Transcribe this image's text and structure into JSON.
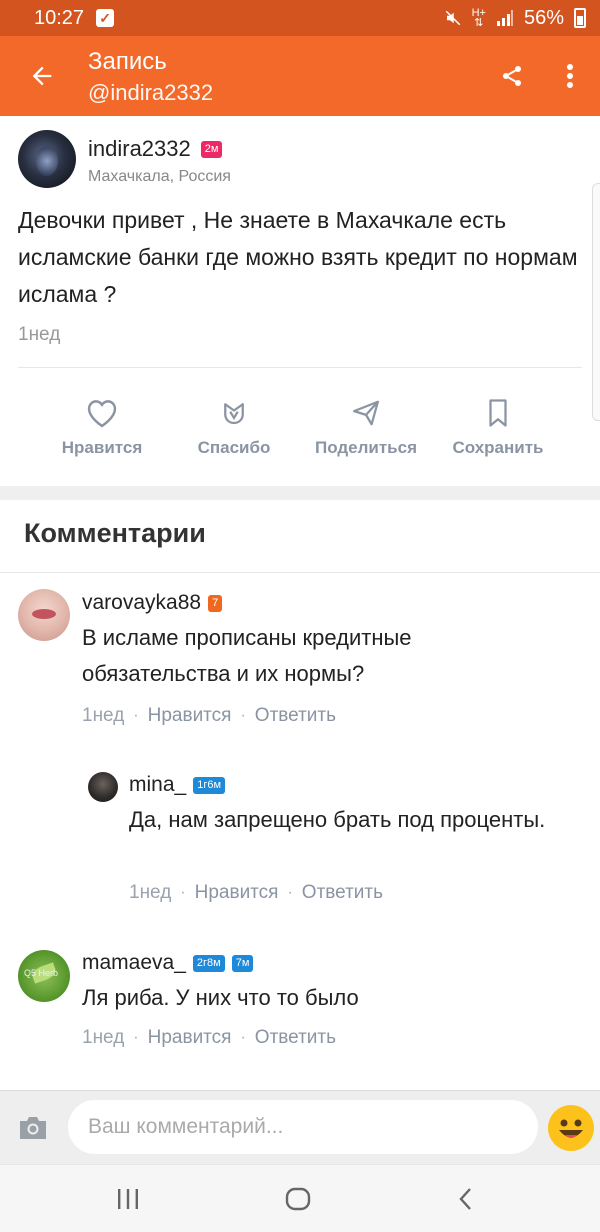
{
  "status_bar": {
    "time": "10:27",
    "battery": "56%",
    "icons": [
      "check-notification-icon",
      "mute-icon",
      "data-icon",
      "signal-icon",
      "battery-icon"
    ]
  },
  "app_bar": {
    "title": "Запись",
    "subtitle": "@indira2332",
    "color": "#f2692a",
    "icons": [
      "back-arrow-icon",
      "share-icon",
      "more-icon"
    ]
  },
  "post": {
    "author": "indira2332",
    "badge": "2м",
    "location": "Махачкала, Россия",
    "text": "Девочки привет , Не знаете в Махачкале есть исламские банки где можно взять кредит по нормам ислама ?",
    "time": "1нед"
  },
  "actions": [
    {
      "label": "Нравится",
      "icon": "heart-icon"
    },
    {
      "label": "Спасибо",
      "icon": "thanks-flower-icon"
    },
    {
      "label": "Поделиться",
      "icon": "send-icon"
    },
    {
      "label": "Сохранить",
      "icon": "bookmark-icon"
    }
  ],
  "comments_section": {
    "title": "Комментарии"
  },
  "comments": [
    {
      "author": "varovayka88",
      "badges": [
        "7"
      ],
      "text": "В исламе прописаны кредитные обязательства и их нормы?",
      "time": "1нед",
      "like": "Нравится",
      "reply": "Ответить"
    },
    {
      "author": "mina_",
      "badges": [
        "1г6м"
      ],
      "text": "Да, нам запрещено брать под проценты.",
      "time": "1нед",
      "like": "Нравится",
      "reply": "Ответить"
    },
    {
      "author": "mamaeva_",
      "badges": [
        "2г8м",
        "7м"
      ],
      "avatar_text": "Q5 Herb",
      "text": "Ля риба. У них что то было",
      "time": "1нед",
      "like": "Нравится",
      "reply": "Ответить"
    }
  ],
  "input": {
    "placeholder": "Ваш комментарий..."
  },
  "nav_bar": {
    "icons": [
      "recent-apps-icon",
      "home-icon",
      "back-icon"
    ]
  }
}
